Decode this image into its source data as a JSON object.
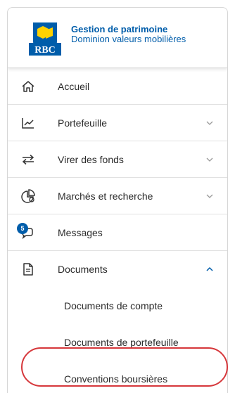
{
  "brand": {
    "line1": "Gestion de patrimoine",
    "line2": "Dominion valeurs mobilières",
    "logo_text": "RBC",
    "color": "#005DAA"
  },
  "nav": {
    "items": [
      {
        "label": "Accueil",
        "icon": "home-icon"
      },
      {
        "label": "Portefeuille",
        "icon": "chart-icon",
        "expandable": true
      },
      {
        "label": "Virer des fonds",
        "icon": "transfer-icon",
        "expandable": true
      },
      {
        "label": "Marchés et recherche",
        "icon": "markets-icon",
        "expandable": true
      },
      {
        "label": "Messages",
        "icon": "messages-icon",
        "badge": "5"
      },
      {
        "label": "Documents",
        "icon": "document-icon",
        "expanded": true
      }
    ],
    "documents_sub": [
      {
        "label": "Documents de compte"
      },
      {
        "label": "Documents de portefeuille"
      },
      {
        "label": "Conventions boursières",
        "highlighted": true
      }
    ]
  },
  "colors": {
    "highlight": "#d6373b",
    "chevron": "#9a9a9a",
    "chevron_active": "#005DAA"
  }
}
